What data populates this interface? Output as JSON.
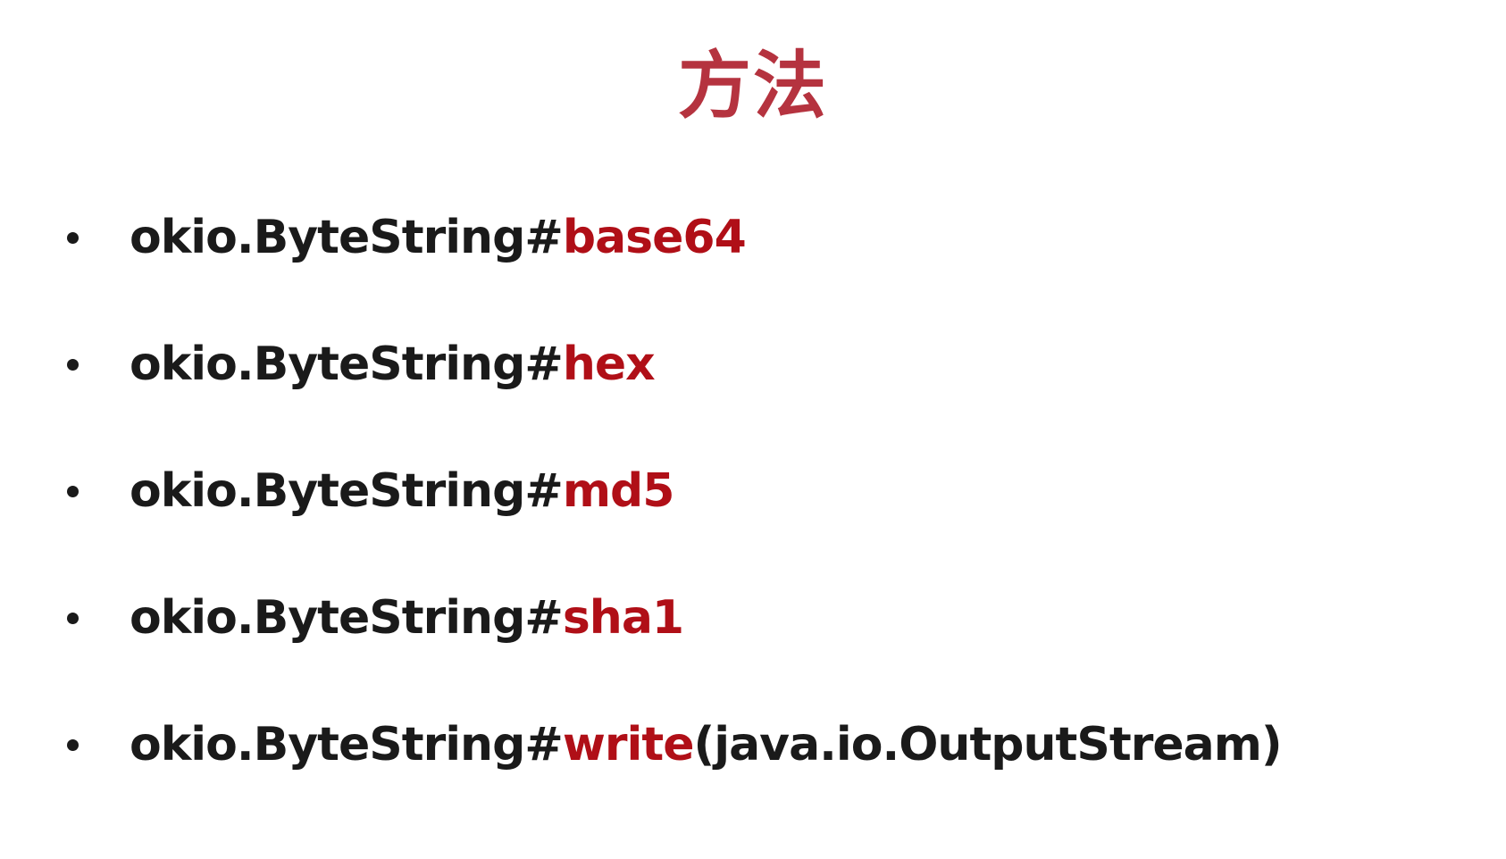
{
  "colors": {
    "title": "#b5333f",
    "text": "#1a1a1a",
    "accent": "#b00f17",
    "bullet": "#1a1a1a"
  },
  "slide": {
    "title": "方法",
    "items": [
      {
        "prefix": "okio.ByteString#",
        "method": "base64",
        "suffix": ""
      },
      {
        "prefix": "okio.ByteString#",
        "method": "hex",
        "suffix": ""
      },
      {
        "prefix": "okio.ByteString#",
        "method": "md5",
        "suffix": ""
      },
      {
        "prefix": "okio.ByteString#",
        "method": "sha1",
        "suffix": ""
      },
      {
        "prefix": "okio.ByteString#",
        "method": "write",
        "suffix": "(java.io.OutputStream)"
      }
    ]
  }
}
